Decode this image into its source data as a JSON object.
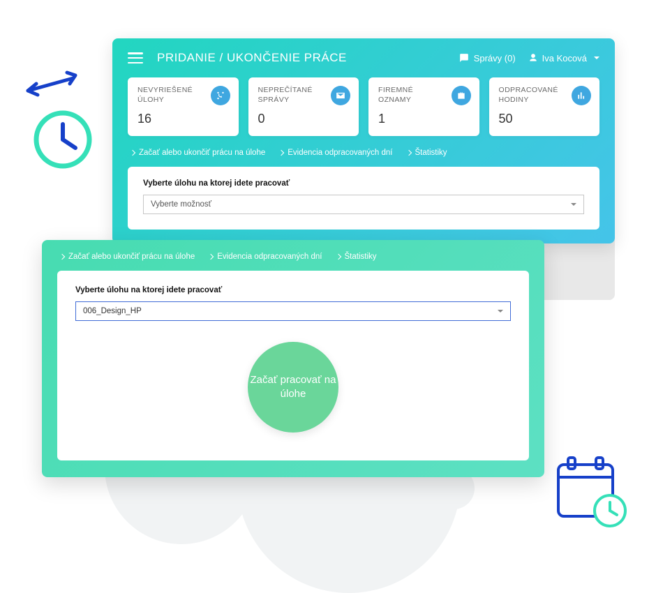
{
  "header": {
    "title": "PRIDANIE / UKONČENIE PRÁCE",
    "messages_label": "Správy (0)",
    "user_name": "Iva Kocová"
  },
  "stats": [
    {
      "label": "NEVYRIEŠENÉ ÚLOHY",
      "value": "16",
      "icon": "branch-icon"
    },
    {
      "label": "NEPREČÍTANÉ SPRÁVY",
      "value": "0",
      "icon": "mail-icon"
    },
    {
      "label": "FIREMNÉ OZNAMY",
      "value": "1",
      "icon": "briefcase-icon"
    },
    {
      "label": "ODPRACOVANÉ HODINY",
      "value": "50",
      "icon": "chart-icon"
    }
  ],
  "crumbs": [
    "Začať alebo ukončiť prácu na úlohe",
    "Evidencia odpracovaných dní",
    "Štatistiky"
  ],
  "panel1": {
    "label": "Vyberte úlohu na ktorej idete pracovať",
    "placeholder": "Vyberte možnosť"
  },
  "panel2": {
    "label": "Vyberte úlohu na ktorej idete pracovať",
    "selected": "006_Design_HP",
    "button": "Začať pracovať na úlohe"
  },
  "icons": {
    "hamburger": "menu-icon",
    "messages": "chat-icon",
    "user": "person-icon",
    "clock_deco": "clock-swap-icon",
    "calendar_deco": "calendar-clock-icon"
  },
  "colors": {
    "gradient_a": "#22d6c0",
    "gradient_b": "#45c4e9",
    "stat_icon_bg": "#3fa7e0",
    "start_btn": "#6ad69a",
    "deco_blue": "#1640c9",
    "deco_teal": "#35e0b8"
  }
}
